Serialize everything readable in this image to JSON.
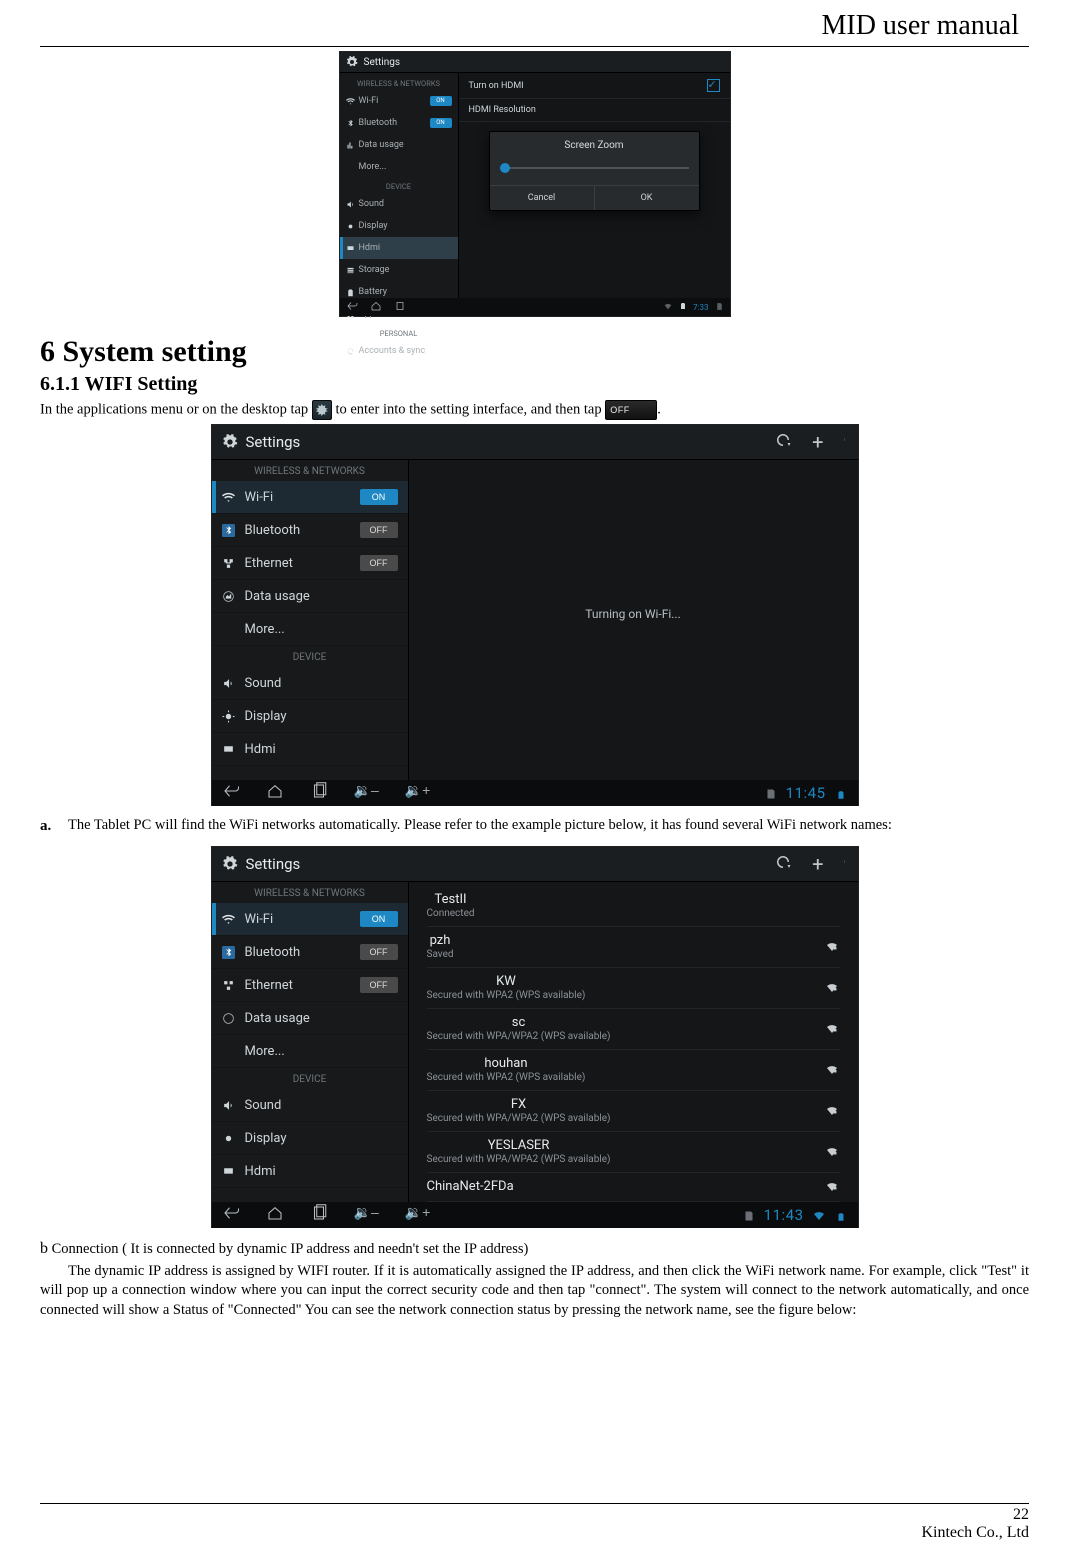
{
  "doc": {
    "header": "MID user manual",
    "page_number": "22",
    "company": "Kintech Co., Ltd"
  },
  "text": {
    "h1": "6 System setting",
    "h2": "6.1.1 WIFI Setting",
    "intro_a": "In the applications menu or on the desktop tap ",
    "intro_b": " to enter into the setting interface, and then tap ",
    "off_label": "OFF",
    "a_marker": "a.",
    "a_text": "The Tablet PC will find the WiFi networks automatically. Please refer to the example picture below, it has found several WiFi network names:",
    "b_marker": "b",
    "b_text": " Connection ( It is connected by dynamic IP address and needn't set the IP address)",
    "para": "The dynamic IP address is assigned by WIFI router. If it is automatically assigned the IP address, and then click the WiFi network name. For example, click \"Test\" it will pop up a connection window where you can input the correct security code and then tap \"connect\". The system will connect to the network automatically, and once connected will show a Status of \"Connected\" You can see the network connection status by pressing the network name, see the figure below:"
  },
  "shot1": {
    "title": "Settings",
    "wn_header": "WIRELESS & NETWORKS",
    "dev_header": "DEVICE",
    "pers_header": "PERSONAL",
    "items": [
      {
        "label": "Wi-Fi",
        "toggle": "ON"
      },
      {
        "label": "Bluetooth",
        "toggle": "ON"
      },
      {
        "label": "Data usage"
      },
      {
        "label": "More..."
      }
    ],
    "dev_items": [
      {
        "label": "Sound"
      },
      {
        "label": "Display"
      },
      {
        "label": "Hdmi",
        "selected": true
      },
      {
        "label": "Storage"
      },
      {
        "label": "Battery"
      },
      {
        "label": "Apps"
      }
    ],
    "pers_items": [
      {
        "label": "Accounts & sync"
      }
    ],
    "main": {
      "row1": "Turn on HDMI",
      "row2": "HDMI Resolution"
    },
    "dialog": {
      "title": "Screen Zoom",
      "cancel": "Cancel",
      "ok": "OK"
    },
    "clock": "7:33"
  },
  "shot2": {
    "title": "Settings",
    "wn_header": "WIRELESS & NETWORKS",
    "dev_header": "DEVICE",
    "items": [
      {
        "label": "Wi-Fi",
        "toggle": "ON",
        "selected": true
      },
      {
        "label": "Bluetooth",
        "toggle": "OFF"
      },
      {
        "label": "Ethernet",
        "toggle": "OFF"
      },
      {
        "label": "Data usage"
      },
      {
        "label": "More..."
      }
    ],
    "dev_items": [
      {
        "label": "Sound"
      },
      {
        "label": "Display"
      },
      {
        "label": "Hdmi"
      }
    ],
    "center": "Turning on Wi-Fi...",
    "vol_minus": "–",
    "vol_plus": "+",
    "clock": "11:45"
  },
  "shot3": {
    "title": "Settings",
    "wn_header": "WIRELESS & NETWORKS",
    "dev_header": "DEVICE",
    "items": [
      {
        "label": "Wi-Fi",
        "toggle": "ON",
        "selected": true
      },
      {
        "label": "Bluetooth",
        "toggle": "OFF"
      },
      {
        "label": "Ethernet",
        "toggle": "OFF"
      },
      {
        "label": "Data usage"
      },
      {
        "label": "More..."
      }
    ],
    "dev_items": [
      {
        "label": "Sound"
      },
      {
        "label": "Display"
      },
      {
        "label": "Hdmi"
      }
    ],
    "networks": [
      {
        "name": "TestII",
        "sub": "Connected"
      },
      {
        "name": "pzh",
        "sub": "Saved"
      },
      {
        "name": "KW",
        "sub": "Secured with WPA2 (WPS available)"
      },
      {
        "name": "sc",
        "sub": "Secured with WPA/WPA2 (WPS available)"
      },
      {
        "name": "houhan",
        "sub": "Secured with WPA2 (WPS available)"
      },
      {
        "name": "FX",
        "sub": "Secured with WPA/WPA2 (WPS available)"
      },
      {
        "name": "YESLASER",
        "sub": "Secured with WPA/WPA2 (WPS available)"
      },
      {
        "name": "ChinaNet-2FDa",
        "sub": ""
      }
    ],
    "vol_minus": "–",
    "vol_plus": "+",
    "clock": "11:43"
  }
}
